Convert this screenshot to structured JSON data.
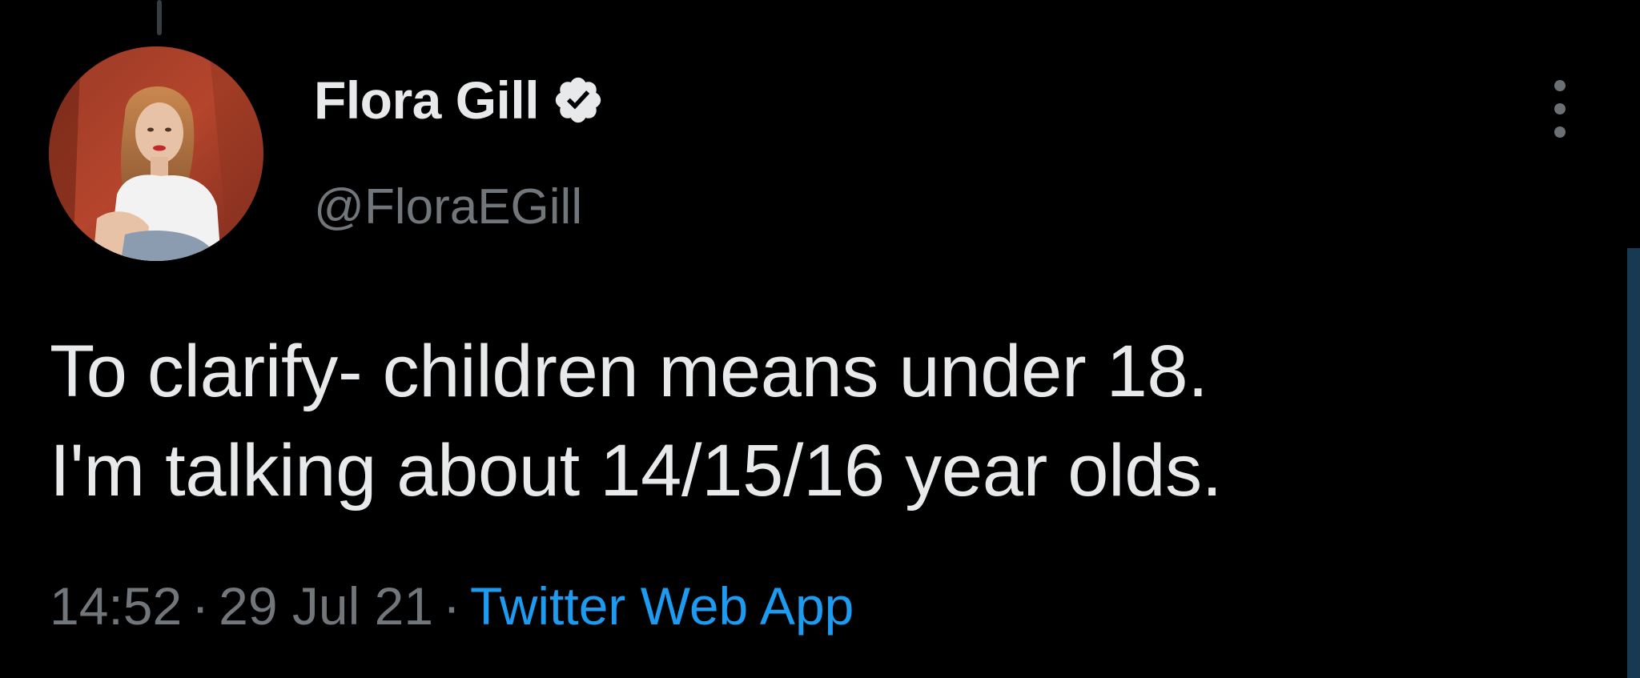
{
  "author": {
    "display_name": "Flora Gill",
    "handle": "@FloraEGill",
    "verified_icon": "verified-badge-icon"
  },
  "tweet": {
    "text_lines": [
      "To clarify- children means under 18.",
      "I'm talking about 14/15/16 year olds."
    ],
    "time": "14:52",
    "date": "29 Jul 21",
    "separator": "·",
    "source": "Twitter Web App"
  },
  "icons": {
    "more": "more-vertical-icon"
  },
  "colors": {
    "background": "#000000",
    "text_primary": "#e7e9ea",
    "text_secondary": "#71767b",
    "link": "#1d9bf0"
  }
}
